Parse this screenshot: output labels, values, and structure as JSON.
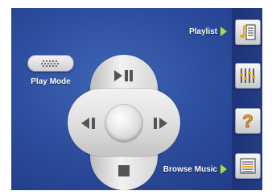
{
  "playmode": {
    "label": "Play Mode"
  },
  "sidebar": {
    "playlist_label": "Playlist",
    "browse_label": "Browse Music"
  },
  "icons": {
    "playmode": "grip-icon",
    "play_pause": "play-pause-icon",
    "prev": "previous-track-icon",
    "next": "next-track-icon",
    "stop": "stop-icon",
    "playlist": "playlist-icon",
    "equalizer": "equalizer-icon",
    "help": "help-icon",
    "browse": "browse-list-icon"
  },
  "colors": {
    "background": "#2a4a9a",
    "sidebar": "#1d3376",
    "label_arrow": "#9ee23a",
    "icon_accent": "#f0a21a",
    "icon_dark": "#333333"
  }
}
